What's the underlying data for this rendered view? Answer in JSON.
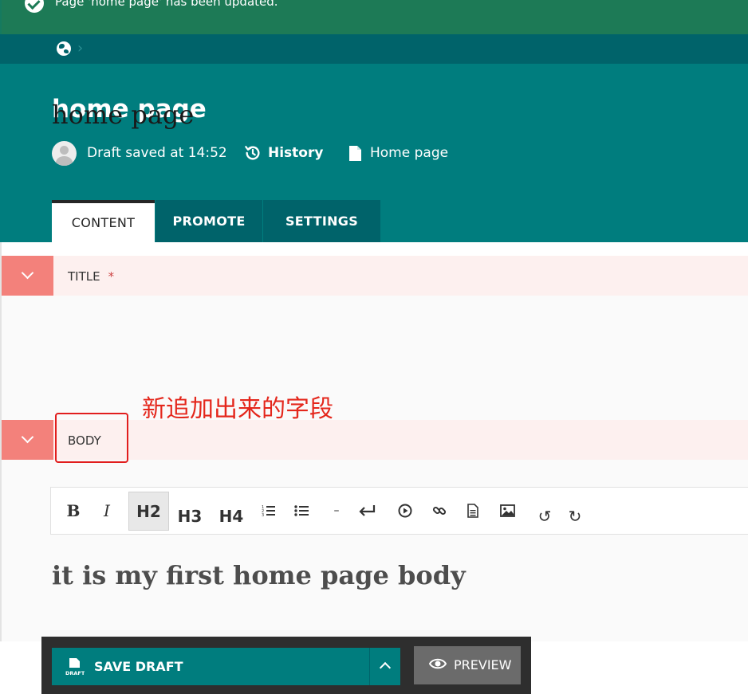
{
  "message": "Page 'home page' has been updated.",
  "header": {
    "page_title": "home page",
    "draft_status": "Draft saved at 14:52",
    "history_label": "History",
    "page_type": "Home page"
  },
  "tabs": [
    {
      "label": "CONTENT",
      "active": true
    },
    {
      "label": "PROMOTE",
      "active": false
    },
    {
      "label": "SETTINGS",
      "active": false
    }
  ],
  "fields": {
    "title": {
      "label": "TITLE",
      "required_marker": "*",
      "value": "home page"
    },
    "body": {
      "label": "BODY",
      "value": "it is my first home page body"
    }
  },
  "annotation": {
    "text": "新追加出来的字段",
    "color": "#e4271c"
  },
  "toolbar": {
    "bold": "B",
    "italic": "I",
    "h2": "H2",
    "h3": "H3",
    "h4": "H4",
    "hr": "–",
    "undo": "↺",
    "redo": "↻"
  },
  "footer": {
    "draft_icon_text": "DRAFT",
    "save_label": "SAVE DRAFT",
    "preview_label": "PREVIEW"
  },
  "colors": {
    "success": "#1d7a56",
    "header": "#007d7e",
    "header_dark": "#00636a",
    "field_toggle": "#f3817b",
    "field_head_bg": "#fdf0ef"
  }
}
